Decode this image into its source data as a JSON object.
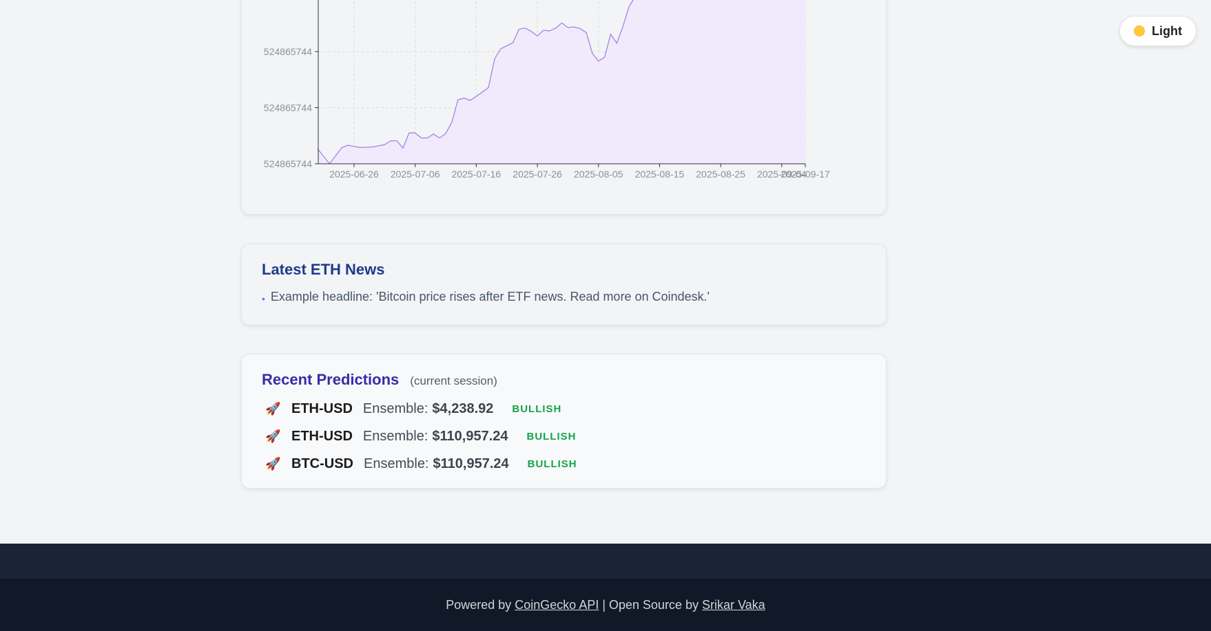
{
  "theme_toggle": {
    "label": "Light"
  },
  "chart_data": {
    "type": "area",
    "x_ticks": [
      "2025-06-26",
      "2025-07-06",
      "2025-07-16",
      "2025-07-26",
      "2025-08-05",
      "2025-08-15",
      "2025-08-25",
      "2025-09-04",
      "2025-09-17"
    ],
    "y_tick_labels": [
      "524865744",
      "524865744",
      "524865744"
    ],
    "line_color": "#9f86e6",
    "fill_color": "#f1eafc",
    "grid": true,
    "series": [
      {
        "values": [
          [
            "2025-06-20",
            0.27
          ],
          [
            "2025-06-22",
            0.0
          ],
          [
            "2025-06-24",
            0.29
          ],
          [
            "2025-06-25",
            0.33
          ],
          [
            "2025-06-27",
            0.29
          ],
          [
            "2025-06-29",
            0.3
          ],
          [
            "2025-07-01",
            0.34
          ],
          [
            "2025-07-02",
            0.41
          ],
          [
            "2025-07-03",
            0.41
          ],
          [
            "2025-07-04",
            0.28
          ],
          [
            "2025-07-05",
            0.55
          ],
          [
            "2025-07-06",
            0.55
          ],
          [
            "2025-07-07",
            0.46
          ],
          [
            "2025-07-08",
            0.46
          ],
          [
            "2025-07-09",
            0.53
          ],
          [
            "2025-07-10",
            0.46
          ],
          [
            "2025-07-11",
            0.54
          ],
          [
            "2025-07-12",
            0.74
          ],
          [
            "2025-07-13",
            1.14
          ],
          [
            "2025-07-14",
            1.17
          ],
          [
            "2025-07-15",
            1.13
          ],
          [
            "2025-07-16",
            1.2
          ],
          [
            "2025-07-18",
            1.36
          ],
          [
            "2025-07-19",
            1.87
          ],
          [
            "2025-07-20",
            2.05
          ],
          [
            "2025-07-22",
            2.16
          ],
          [
            "2025-07-23",
            2.4
          ],
          [
            "2025-07-24",
            2.42
          ],
          [
            "2025-07-25",
            2.36
          ],
          [
            "2025-07-26",
            2.28
          ],
          [
            "2025-07-27",
            2.38
          ],
          [
            "2025-07-28",
            2.37
          ],
          [
            "2025-07-29",
            2.42
          ],
          [
            "2025-07-30",
            2.51
          ],
          [
            "2025-07-31",
            2.43
          ],
          [
            "2025-08-01",
            2.44
          ],
          [
            "2025-08-02",
            2.41
          ],
          [
            "2025-08-03",
            2.34
          ],
          [
            "2025-08-04",
            1.97
          ],
          [
            "2025-08-05",
            1.83
          ],
          [
            "2025-08-06",
            1.9
          ],
          [
            "2025-08-07",
            2.31
          ],
          [
            "2025-08-08",
            2.15
          ],
          [
            "2025-08-09",
            2.45
          ],
          [
            "2025-08-10",
            2.8
          ],
          [
            "2025-08-11",
            2.98
          ]
        ]
      }
    ]
  },
  "news": {
    "title": "Latest ETH News",
    "items": [
      {
        "bullet": "•",
        "text": "Example headline: 'Bitcoin price rises after ETF news. Read more on Coindesk.'"
      }
    ]
  },
  "predictions": {
    "title": "Recent Predictions",
    "subtitle": "(current session)",
    "rows": [
      {
        "icon": "rocket-icon",
        "symbol": "ETH-USD",
        "label": "Ensemble:",
        "price": "$4,238.92",
        "sentiment": "BULLISH"
      },
      {
        "icon": "rocket-icon",
        "symbol": "ETH-USD",
        "label": "Ensemble:",
        "price": "$110,957.24",
        "sentiment": "BULLISH"
      },
      {
        "icon": "rocket-icon",
        "symbol": "BTC-USD",
        "label": "Ensemble:",
        "price": "$110,957.24",
        "sentiment": "BULLISH"
      }
    ]
  },
  "footer": {
    "prefix": "Powered by ",
    "api_link": "CoinGecko API",
    "middle": " | Open Source by ",
    "author_link": "Srikar Vaka"
  }
}
